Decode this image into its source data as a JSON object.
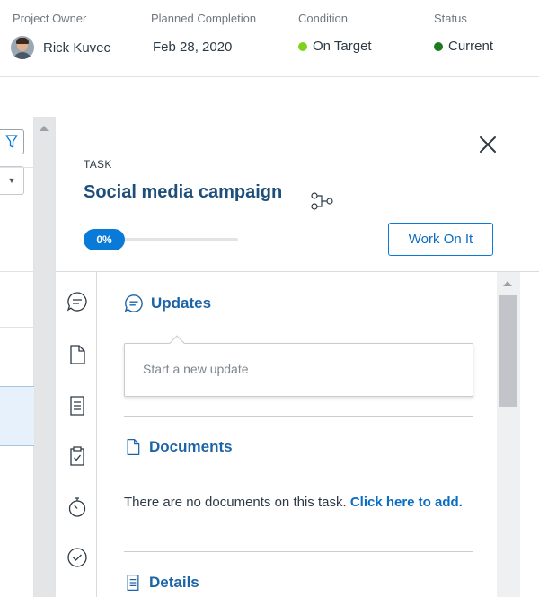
{
  "summary": {
    "owner_label": "Project Owner",
    "owner_name": "Rick Kuvec",
    "completion_label": "Planned Completion",
    "completion_value": "Feb 28, 2020",
    "condition_label": "Condition",
    "condition_value": "On Target",
    "condition_color": "#7ed321",
    "status_label": "Status",
    "status_value": "Current",
    "status_color": "#1e7a1e"
  },
  "task": {
    "kind_label": "TASK",
    "title": "Social media campaign",
    "progress_label": "0%",
    "progress_value": 0,
    "work_button": "Work On It"
  },
  "sections": {
    "updates_title": "Updates",
    "update_placeholder": "Start a new update",
    "documents_title": "Documents",
    "no_documents_text": "There are no documents on this task. ",
    "add_link": "Click here to add.",
    "details_title": "Details"
  },
  "icons": {
    "filter": "filter-icon",
    "dropdown": "chevron-down-icon",
    "close": "close-icon",
    "flow": "dependency-icon",
    "rail": [
      "chat-icon",
      "document-icon",
      "details-icon",
      "clipboard-check-icon",
      "timer-icon",
      "check-circle-icon"
    ]
  },
  "accent_color": "#0a7ad8"
}
